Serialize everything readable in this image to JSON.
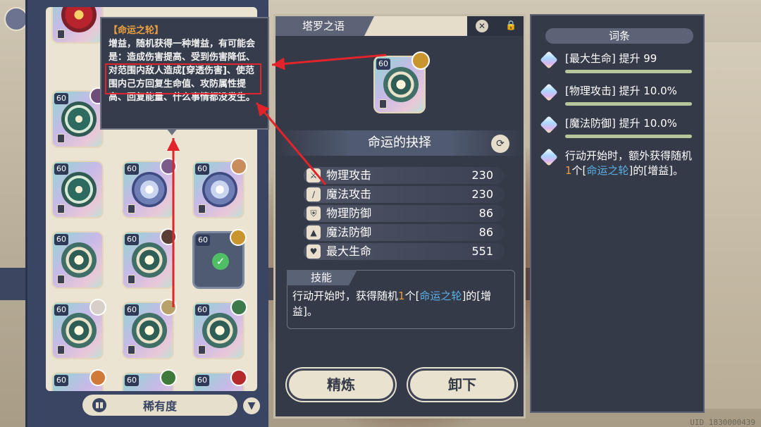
{
  "tooltip": {
    "title": "【命运之轮】",
    "body": "增益，随机获得一种增益，有可能会是：造成伤害提高、受到伤害降低、对范围内敌人造成[穿透伤害]、使范围内己方回复生命值、攻防属性提高、回复能量、什么事情都没发生。"
  },
  "cards": {
    "level": "60",
    "rows": [
      [
        "60",
        "60",
        "60"
      ],
      [
        "60",
        "60",
        "60"
      ],
      [
        "60",
        "60",
        "60"
      ],
      [
        "60",
        "60",
        "60"
      ],
      [
        "60",
        "60",
        "60"
      ]
    ]
  },
  "left_footer": {
    "rarity_label": "稀有度"
  },
  "middle": {
    "header_title": "塔罗之语",
    "card_level": "60",
    "choice_title": "命运的抉择",
    "stats": [
      {
        "name": "物理攻击",
        "value": "230",
        "icon": "sword-icon"
      },
      {
        "name": "魔法攻击",
        "value": "230",
        "icon": "wand-icon"
      },
      {
        "name": "物理防御",
        "value": "86",
        "icon": "shield-icon"
      },
      {
        "name": "魔法防御",
        "value": "86",
        "icon": "hat-icon"
      },
      {
        "name": "最大生命",
        "value": "551",
        "icon": "heart-icon"
      }
    ],
    "skill_tag": "技能",
    "skill_text": {
      "p1": "行动开始时，获得随机",
      "num": "1",
      "p2": "个[",
      "link": "命运之轮",
      "p3": "]的[增益]。"
    },
    "btn_refine": "精炼",
    "btn_unequip": "卸下"
  },
  "right": {
    "header": "词条",
    "entries": [
      {
        "text": "[最大生命] 提升 99"
      },
      {
        "text": "[物理攻击] 提升 10.0%"
      },
      {
        "text": "[魔法防御] 提升 10.0%"
      }
    ],
    "effect": {
      "p1": "行动开始时，额外获得随机",
      "num": "1",
      "p2": "个[",
      "link": "命运之轮",
      "p3": "]的[增益]。"
    }
  },
  "uid": "UID 1830000439",
  "colors": {
    "panel": "#343a48",
    "highlight_red": "#e0242a",
    "orange": "#f09a3a",
    "blue_link": "#5bb0e6",
    "tooltip_title": "#f0a03c"
  }
}
